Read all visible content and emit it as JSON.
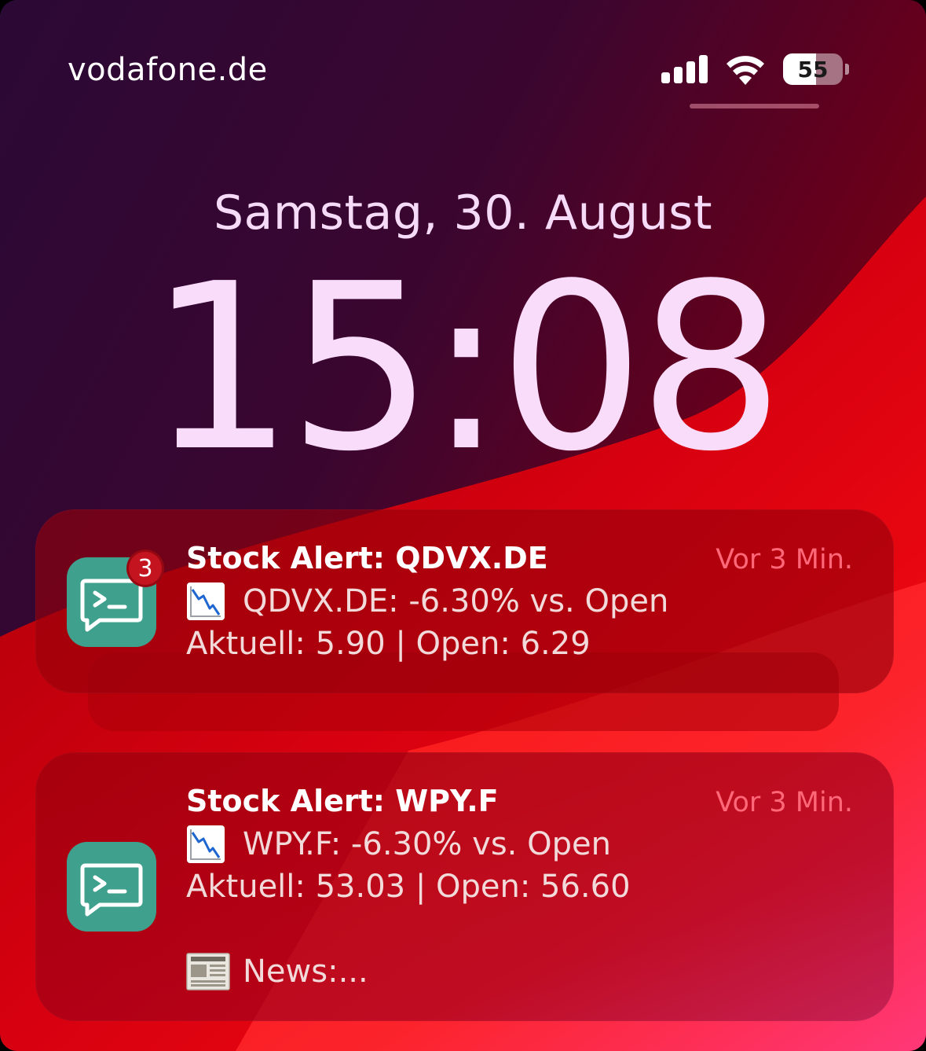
{
  "status_bar": {
    "carrier": "vodafone.de",
    "battery_percent": 55,
    "battery_label": "55",
    "signal_bars": 4
  },
  "lock_screen": {
    "date": "Samstag, 30. August",
    "time": "15:08"
  },
  "notifications": [
    {
      "title": "Stock Alert: QDVX.DE",
      "time": "Vor 3 Min.",
      "badge": "3",
      "line1": "QDVX.DE: -6.30% vs. Open",
      "line2": "Aktuell: 5.90 | Open: 6.29",
      "icon": "terminal-chat-icon"
    },
    {
      "title": "Stock Alert: WPY.F",
      "time": "Vor 3 Min.",
      "line1": "WPY.F: -6.30% vs. Open",
      "line2": "Aktuell: 53.03 | Open: 56.60",
      "line3": "News:...",
      "icon": "terminal-chat-icon"
    }
  ],
  "colors": {
    "app_icon": "#3fa18d",
    "badge": "#c41420",
    "timestamp": "#ff6878",
    "date_time_text": "#f8dcfa"
  }
}
